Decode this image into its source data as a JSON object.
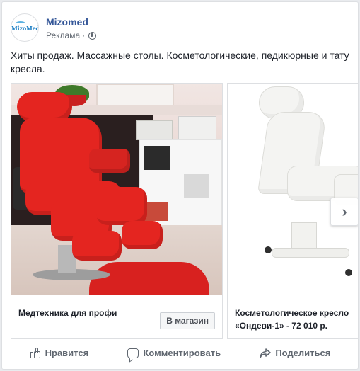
{
  "post": {
    "page_name": "Mizomed",
    "logo_text": "MizoMed",
    "sponsored_label": "Реклама",
    "separator": "·",
    "text": "Хиты продаж. Массажные столы. Косметологические, педикюрные и тату кресла."
  },
  "carousel": {
    "cards": [
      {
        "caption": "Медтехника для профи",
        "button_label": "В магазин"
      },
      {
        "caption": "Косметологическое кресло «Ондеви-1» - 72 010 р."
      }
    ],
    "next_glyph": "›"
  },
  "actions": {
    "like_label": "Нравится",
    "comment_label": "Комментировать",
    "share_label": "Поделиться"
  },
  "colors": {
    "page_name": "#365899",
    "meta_text": "#606770",
    "chair_red": "#e42520",
    "rug_red": "#d8211f"
  }
}
